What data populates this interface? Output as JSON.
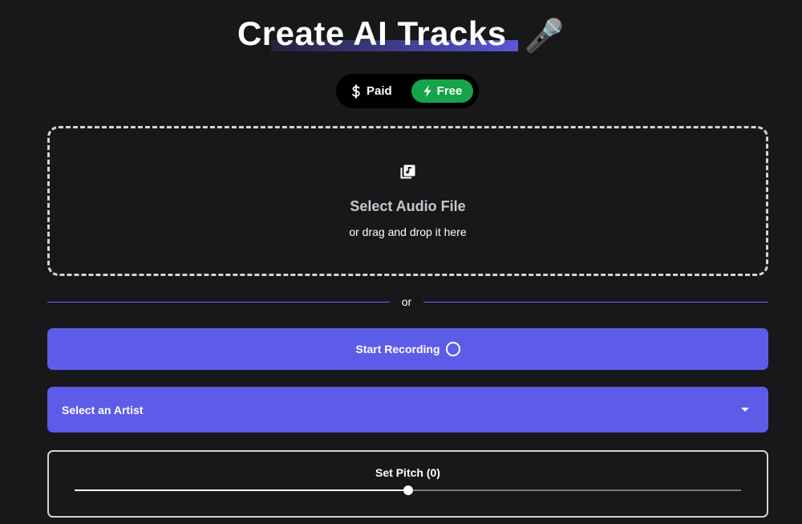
{
  "header": {
    "title": "Create AI Tracks",
    "emoji": "🎤",
    "emoji_icon": "microphone-icon",
    "underline_color": "#5b56d6"
  },
  "plan_toggle": {
    "paid_label": "Paid",
    "paid_icon": "dollar-icon",
    "free_label": "Free",
    "free_icon": "lightning-icon",
    "selected": "Free",
    "selected_color": "#16a34a"
  },
  "upload": {
    "icon": "music-library-icon",
    "title": "Select Audio File",
    "subtitle": "or drag and drop it here"
  },
  "divider": {
    "label": "or"
  },
  "record": {
    "label": "Start Recording",
    "icon": "record-circle-icon",
    "color": "#5d5ce8"
  },
  "artist_select": {
    "placeholder": "Select an Artist",
    "icon": "caret-down-icon"
  },
  "pitch": {
    "label": "Set Pitch (0)",
    "value": 0,
    "min": -12,
    "max": 12
  }
}
